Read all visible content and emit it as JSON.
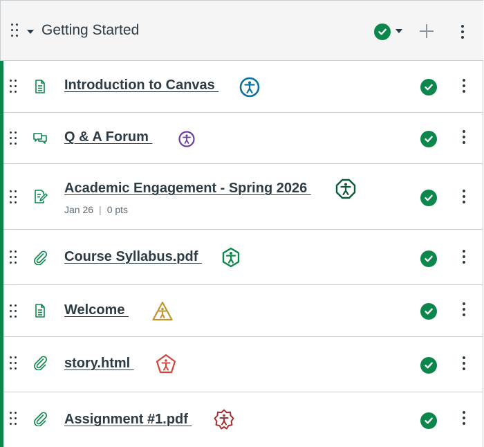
{
  "module": {
    "title": "Getting Started",
    "published": true
  },
  "colors": {
    "published_green": "#0b874b",
    "link_text": "#2d3b45",
    "a11y_blue": "#0a6fa3",
    "a11y_purple": "#6b3fa0",
    "a11y_darkgreen": "#0b5a3a",
    "a11y_green": "#0b874b",
    "a11y_gold": "#c0962b",
    "a11y_red": "#d0443a",
    "a11y_darkred": "#a62d2d"
  },
  "items": [
    {
      "title": "Introduction to Canvas ",
      "type_icon": "page-icon",
      "a11y_icon": "accessibility-circle-icon-blue"
    },
    {
      "title": "Q & A Forum ",
      "type_icon": "discussion-icon",
      "a11y_icon": "accessibility-circle-icon-purple"
    },
    {
      "title": "Academic Engagement - Spring 2026 ",
      "type_icon": "assignment-icon",
      "a11y_icon": "accessibility-octagon-icon-darkgreen",
      "due": "Jan 26",
      "points": "0 pts"
    },
    {
      "title": "Course Syllabus.pdf ",
      "type_icon": "attachment-icon",
      "a11y_icon": "accessibility-hexagon-icon-green"
    },
    {
      "title": "Welcome ",
      "type_icon": "page-icon",
      "a11y_icon": "accessibility-triangle-icon-gold"
    },
    {
      "title": "story.html ",
      "type_icon": "attachment-icon",
      "a11y_icon": "accessibility-pentagon-icon-red"
    },
    {
      "title": "Assignment #1.pdf ",
      "type_icon": "attachment-icon",
      "a11y_icon": "accessibility-star-icon-darkred"
    }
  ]
}
